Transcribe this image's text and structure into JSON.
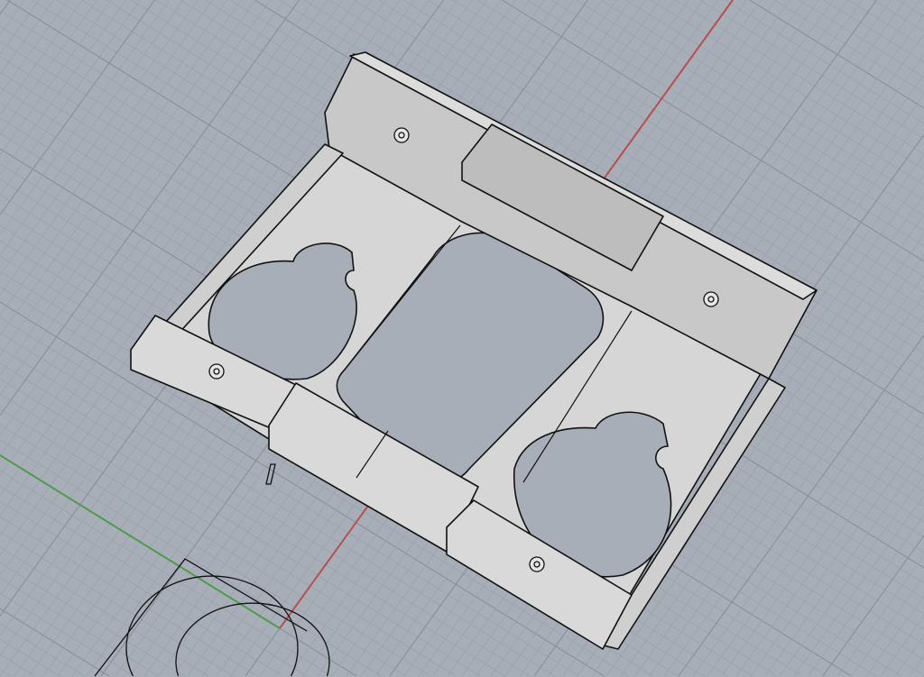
{
  "viewport": {
    "background_color": "#a8aeb8",
    "grid_minor_color": "#9aa1ab",
    "grid_major_color": "#8a919b",
    "x_axis_color": "#b5504f",
    "y_axis_color": "#4f9a4f",
    "model_face_color": "#d6d6d6",
    "model_shade_color": "#a9a9a9",
    "icons": [
      "screw-hole-icon"
    ]
  }
}
